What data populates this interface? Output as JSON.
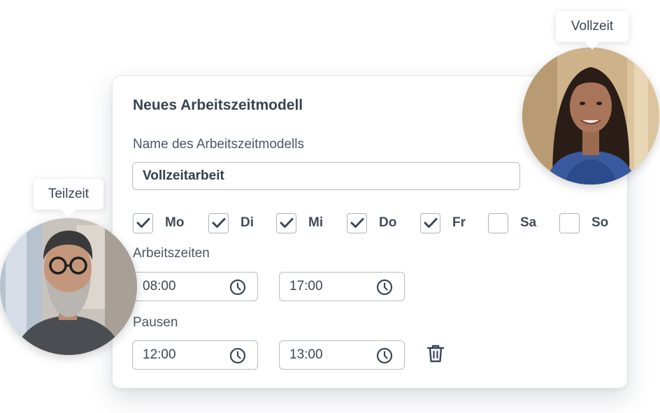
{
  "form": {
    "title": "Neues Arbeitszeitmodell",
    "name_label": "Name des Arbeitszeitmodells",
    "name_value": "Vollzeitarbeit",
    "days": [
      {
        "label": "Mo",
        "checked": true
      },
      {
        "label": "Di",
        "checked": true
      },
      {
        "label": "Mi",
        "checked": true
      },
      {
        "label": "Do",
        "checked": true
      },
      {
        "label": "Fr",
        "checked": true
      },
      {
        "label": "Sa",
        "checked": false
      },
      {
        "label": "So",
        "checked": false
      }
    ],
    "work_hours_label": "Arbeitszeiten",
    "work_start": "08:00",
    "work_end": "17:00",
    "breaks_label": "Pausen",
    "break_start": "12:00",
    "break_end": "13:00"
  },
  "badges": {
    "left": "Teilzeit",
    "right": "Vollzeit"
  },
  "colors": {
    "check": "#3a4658",
    "border": "#b7bcc4"
  },
  "icons": [
    "checkmark-icon",
    "clock-icon",
    "trash-icon"
  ]
}
